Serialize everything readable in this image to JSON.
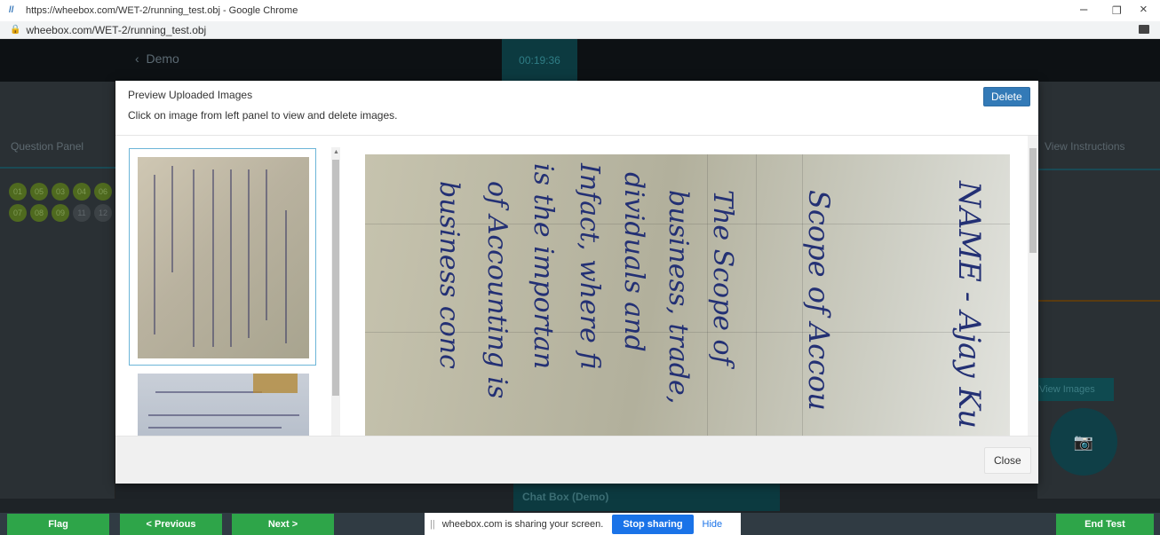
{
  "browser": {
    "window_title": "https://wheebox.com/WET-2/running_test.obj - Google Chrome",
    "address": "wheebox.com/WET-2/running_test.obj",
    "controls": {
      "minimize": "–",
      "maximize": "❐",
      "close": "×"
    }
  },
  "app": {
    "back_label": "Demo",
    "timer": "00:19:36",
    "question_panel_title": "Question Panel",
    "questions": [
      {
        "num": "01",
        "status": "answered"
      },
      {
        "num": "05",
        "status": "answered"
      },
      {
        "num": "03",
        "status": "answered"
      },
      {
        "num": "04",
        "status": "answered"
      },
      {
        "num": "06",
        "status": "answered"
      },
      {
        "num": "07",
        "status": "answered"
      },
      {
        "num": "08",
        "status": "answered"
      },
      {
        "num": "09",
        "status": "answered"
      },
      {
        "num": "11",
        "status": "plain"
      },
      {
        "num": "12",
        "status": "plain"
      }
    ],
    "view_instructions": "View Instructions",
    "view_images": "View Images",
    "chat_box": "Chat Box (Demo)"
  },
  "modal": {
    "title": "Preview Uploaded Images",
    "subtitle": "Click on image from left panel to view and delete images.",
    "delete_label": "Delete",
    "close_label": "Close",
    "preview_text": {
      "line1": "NAME - Ajay Ku",
      "line2": "Scope of Accou",
      "line3": "The Scope of",
      "line4": "business, trade,",
      "line5": "dividuals and",
      "line6": "Infact, where fi",
      "line7": "is the importan",
      "line8": "of Accounting is",
      "line9": "business conc"
    }
  },
  "bottom": {
    "flag": "Flag",
    "previous": "< Previous",
    "next": "Next >",
    "end_test": "End Test"
  },
  "share_bar": {
    "message": "wheebox.com is sharing your screen.",
    "stop_label": "Stop sharing",
    "hide_label": "Hide"
  },
  "colors": {
    "primary_button": "#337ab7",
    "green_button": "#2ea549",
    "stop_sharing": "#1a73e8",
    "ink": "#233074"
  }
}
